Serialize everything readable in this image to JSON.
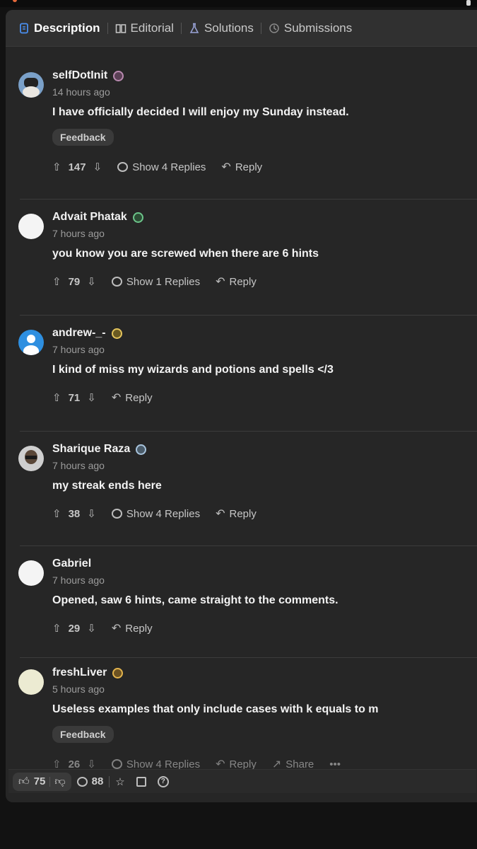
{
  "tabs": [
    {
      "label": "Description",
      "icon": "document-icon",
      "active": true
    },
    {
      "label": "Editorial",
      "icon": "book-icon",
      "active": false
    },
    {
      "label": "Solutions",
      "icon": "flask-icon",
      "active": false
    },
    {
      "label": "Submissions",
      "icon": "history-icon",
      "active": false
    }
  ],
  "comments": [
    {
      "user": "selfDotInit",
      "time": "14 hours ago",
      "text": "I have officially decided I will enjoy my Sunday instead.",
      "tag": "Feedback",
      "votes": "147",
      "replies": "Show 4 Replies",
      "reply_label": "Reply"
    },
    {
      "user": "Advait Phatak",
      "time": "7 hours ago",
      "text": "you know you are screwed when there are 6 hints",
      "tag": "",
      "votes": "79",
      "replies": "Show 1 Replies",
      "reply_label": "Reply"
    },
    {
      "user": "andrew-_-",
      "time": "7 hours ago",
      "text": "I kind of miss my wizards and potions and spells </3",
      "tag": "",
      "votes": "71",
      "replies": "",
      "reply_label": "Reply"
    },
    {
      "user": "Sharique Raza",
      "time": "7 hours ago",
      "text": "my streak ends here",
      "tag": "",
      "votes": "38",
      "replies": "Show 4 Replies",
      "reply_label": "Reply"
    },
    {
      "user": "Gabriel",
      "time": "7 hours ago",
      "text": "Opened, saw 6 hints, came straight to the comments.",
      "tag": "",
      "votes": "29",
      "replies": "",
      "reply_label": "Reply"
    },
    {
      "user": "freshLiver",
      "time": "5 hours ago",
      "text": "Useless examples that only include cases with k equals to m",
      "tag": "Feedback",
      "votes": "26",
      "replies": "Show 4 Replies",
      "reply_label": "Reply",
      "share_label": "Share"
    }
  ],
  "bottom_bar": {
    "likes": "75",
    "comments": "88"
  }
}
